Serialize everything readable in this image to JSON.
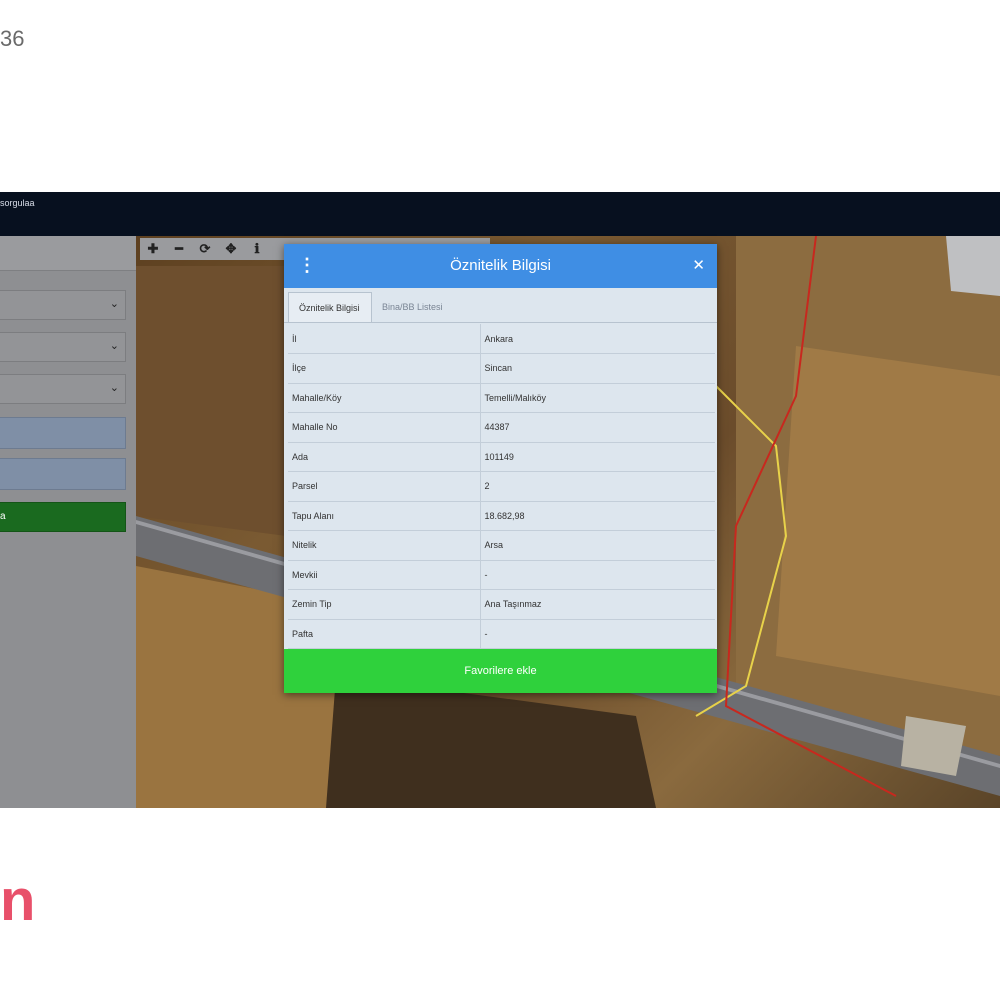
{
  "page": {
    "corner_number": "36",
    "brand_fragment": "n"
  },
  "window": {
    "title": "sorgulaa"
  },
  "sidebar": {
    "header": "",
    "selects": [
      {
        "value": "",
        "icon": "chevron-down-icon"
      },
      {
        "value": "",
        "icon": "chevron-down-icon"
      },
      {
        "value": "",
        "icon": "chevron-down-icon"
      }
    ],
    "inputs": [
      {
        "value": ""
      },
      {
        "value": ""
      }
    ],
    "query_button_label": "a"
  },
  "map_toolbar": {
    "tools": [
      {
        "name": "zoom-in-icon",
        "glyph": "✚"
      },
      {
        "name": "zoom-out-icon",
        "glyph": "━"
      },
      {
        "name": "refresh-icon",
        "glyph": "⟳"
      },
      {
        "name": "locate-icon",
        "glyph": "✥"
      },
      {
        "name": "info-icon",
        "glyph": "ℹ"
      }
    ]
  },
  "modal": {
    "title": "Öznitelik Bilgisi",
    "menu_glyph": "⋮",
    "close_glyph": "✕",
    "tabs": [
      {
        "label": "Öznitelik Bilgisi",
        "active": true
      },
      {
        "label": "Bina/BB Listesi",
        "active": false
      }
    ],
    "rows": [
      {
        "label": "İl",
        "value": "Ankara"
      },
      {
        "label": "İlçe",
        "value": "Sincan"
      },
      {
        "label": "Mahalle/Köy",
        "value": "Temelli/Malıköy"
      },
      {
        "label": "Mahalle No",
        "value": "44387"
      },
      {
        "label": "Ada",
        "value": "101149"
      },
      {
        "label": "Parsel",
        "value": "2"
      },
      {
        "label": "Tapu Alanı",
        "value": "18.682,98"
      },
      {
        "label": "Nitelik",
        "value": "Arsa"
      },
      {
        "label": "Mevkii",
        "value": "-"
      },
      {
        "label": "Zemin Tip",
        "value": "Ana Taşınmaz"
      },
      {
        "label": "Pafta",
        "value": "-"
      }
    ],
    "favorite_button": "Favorilere ekle"
  },
  "colors": {
    "modal_header": "#3f8ee4",
    "favorite_button": "#2fd13c",
    "sidebar_button": "#1a6a1f",
    "parcel_border": "#c8281e",
    "road_line": "#e8d24a"
  }
}
